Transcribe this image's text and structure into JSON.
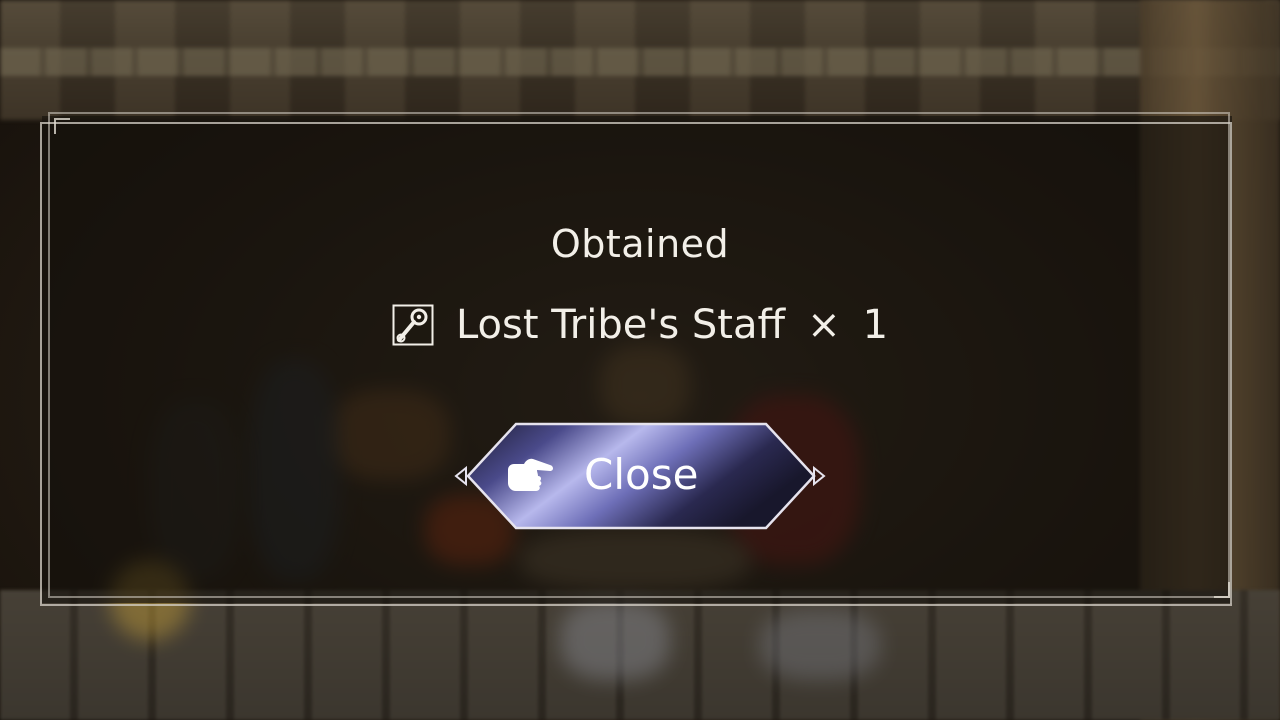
{
  "dialog": {
    "title": "Obtained",
    "item": {
      "icon": "staff-icon",
      "name": "Lost Tribe's Staff",
      "times_symbol": "×",
      "quantity": "1"
    }
  },
  "close_button": {
    "label": "Close",
    "icon": "pointing-hand-icon"
  },
  "colors": {
    "text": "#f2efe8",
    "frame": "#d7d2c8",
    "button_fill_light": "#8d8fd6",
    "button_fill_dark": "#1b1a33"
  }
}
